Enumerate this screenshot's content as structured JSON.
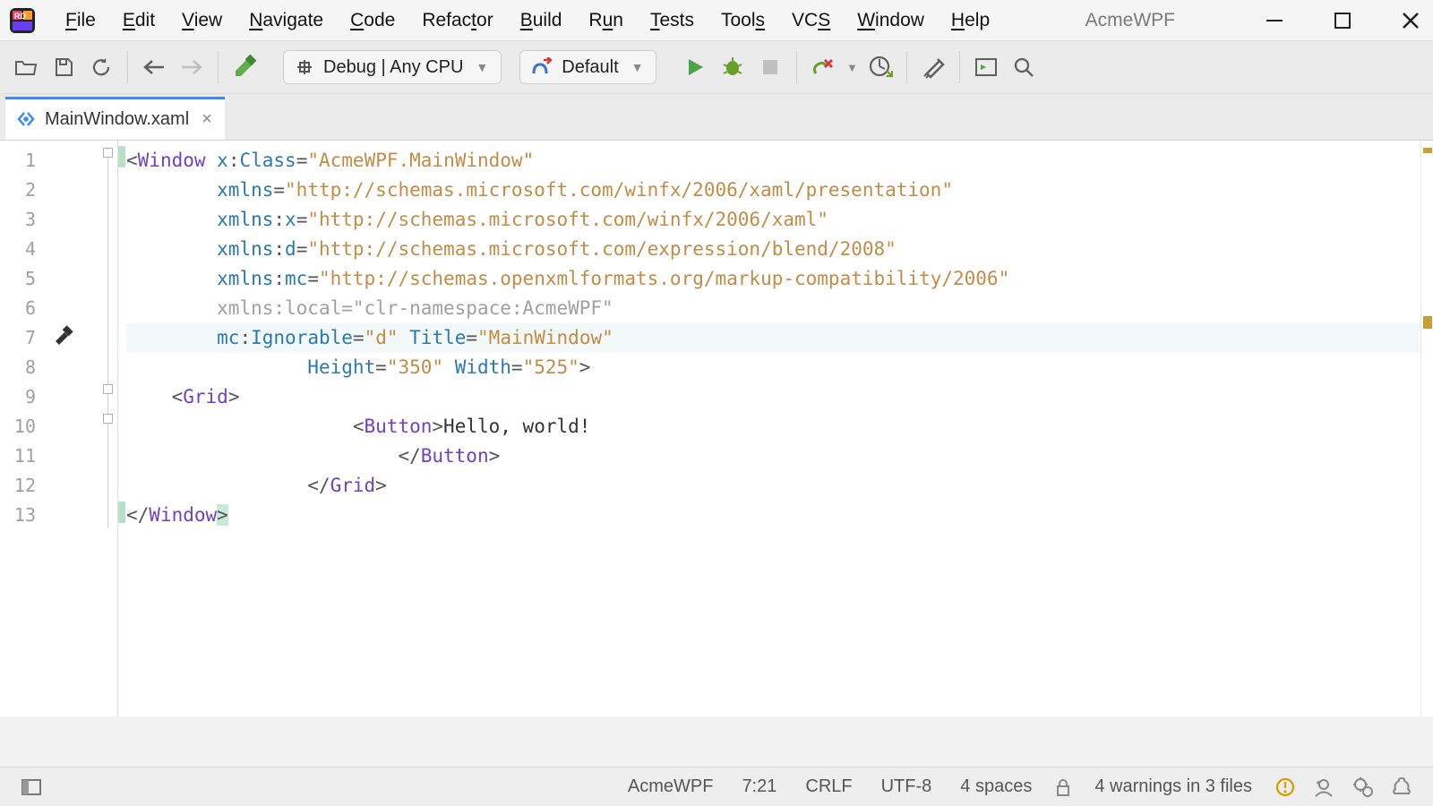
{
  "menubar": {
    "items": [
      "File",
      "Edit",
      "View",
      "Navigate",
      "Code",
      "Refactor",
      "Build",
      "Run",
      "Tests",
      "Tools",
      "VCS",
      "Window",
      "Help"
    ],
    "project": "AcmeWPF"
  },
  "toolbar": {
    "config_label": "Debug | Any CPU",
    "run_config_label": "Default"
  },
  "tabs": [
    {
      "label": "MainWindow.xaml"
    }
  ],
  "editor": {
    "line_count": 13,
    "current_line": 7,
    "lines_tokens": [
      [
        [
          "<",
          "punc"
        ],
        [
          "Window",
          "tag"
        ],
        [
          " ",
          "txt"
        ],
        [
          "x",
          "attr"
        ],
        [
          ":",
          "punc"
        ],
        [
          "Class",
          "attr"
        ],
        [
          "=",
          "punc"
        ],
        [
          "\"AcmeWPF.MainWindow\"",
          "str"
        ]
      ],
      [
        [
          "        ",
          "txt"
        ],
        [
          "xmlns",
          "attr"
        ],
        [
          "=",
          "punc"
        ],
        [
          "\"http://schemas.microsoft.com/winfx/2006/xaml/presentation\"",
          "str"
        ]
      ],
      [
        [
          "        ",
          "txt"
        ],
        [
          "xmlns",
          "attr"
        ],
        [
          ":",
          "punc"
        ],
        [
          "x",
          "attr"
        ],
        [
          "=",
          "punc"
        ],
        [
          "\"http://schemas.microsoft.com/winfx/2006/xaml\"",
          "str"
        ]
      ],
      [
        [
          "        ",
          "txt"
        ],
        [
          "xmlns",
          "attr"
        ],
        [
          ":",
          "punc"
        ],
        [
          "d",
          "attr"
        ],
        [
          "=",
          "punc"
        ],
        [
          "\"http://schemas.microsoft.com/expression/blend/2008\"",
          "str"
        ]
      ],
      [
        [
          "        ",
          "txt"
        ],
        [
          "xmlns",
          "attr"
        ],
        [
          ":",
          "punc"
        ],
        [
          "mc",
          "attr"
        ],
        [
          "=",
          "punc"
        ],
        [
          "\"http://schemas.openxmlformats.org/markup-compatibility/2006\"",
          "str"
        ]
      ],
      [
        [
          "        ",
          "txt"
        ],
        [
          "xmlns:local=\"clr-namespace:AcmeWPF\"",
          "strg"
        ]
      ],
      [
        [
          "        ",
          "txt"
        ],
        [
          "mc",
          "attr"
        ],
        [
          ":",
          "punc"
        ],
        [
          "Ignorable",
          "attr"
        ],
        [
          "=",
          "punc"
        ],
        [
          "\"d\"",
          "str"
        ],
        [
          " ",
          "txt"
        ],
        [
          "Title",
          "attr"
        ],
        [
          "=",
          "punc"
        ],
        [
          "\"MainWindow\"",
          "str"
        ]
      ],
      [
        [
          "                ",
          "txt"
        ],
        [
          "Height",
          "attr"
        ],
        [
          "=",
          "punc"
        ],
        [
          "\"350\"",
          "str"
        ],
        [
          " ",
          "txt"
        ],
        [
          "Width",
          "attr"
        ],
        [
          "=",
          "punc"
        ],
        [
          "\"525\"",
          "str"
        ],
        [
          ">",
          "punc"
        ]
      ],
      [
        [
          "    ",
          "txt"
        ],
        [
          "<",
          "punc"
        ],
        [
          "Grid",
          "tag"
        ],
        [
          ">",
          "punc"
        ]
      ],
      [
        [
          "                    ",
          "txt"
        ],
        [
          "<",
          "punc"
        ],
        [
          "Button",
          "tag"
        ],
        [
          ">",
          "punc"
        ],
        [
          "Hello, world!",
          "txt"
        ]
      ],
      [
        [
          "                        ",
          "txt"
        ],
        [
          "</",
          "punc"
        ],
        [
          "Button",
          "tag"
        ],
        [
          ">",
          "punc"
        ]
      ],
      [
        [
          "                ",
          "txt"
        ],
        [
          "</",
          "punc"
        ],
        [
          "Grid",
          "tag"
        ],
        [
          ">",
          "punc"
        ]
      ],
      [
        [
          "</",
          "punc"
        ],
        [
          "Window",
          "tag"
        ],
        [
          ">",
          "punc"
        ]
      ]
    ]
  },
  "status": {
    "project": "AcmeWPF",
    "caret": "7:21",
    "line_sep": "CRLF",
    "encoding": "UTF-8",
    "indent": "4 spaces",
    "warnings": "4 warnings in 3 files"
  },
  "colors": {
    "accent": "#3b8eed",
    "run_green": "#48a648",
    "bug_green": "#6aa028",
    "warn": "#d4a000",
    "err": "#c44"
  }
}
